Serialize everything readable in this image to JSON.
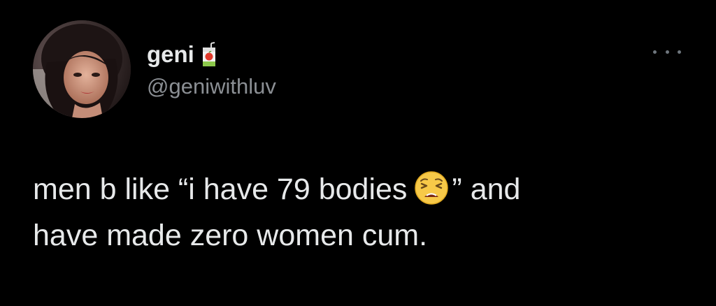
{
  "user": {
    "display_name": "geni",
    "name_emoji_icon": "juice-box-icon",
    "handle": "@geniwithluv",
    "avatar_icon": "profile-photo"
  },
  "menu": {
    "more_icon": "more-options-icon"
  },
  "tweet": {
    "line1_before_emoji": "men b like “i have 79 bodies",
    "emoji_icon": "weary-face-emoji",
    "line1_after_emoji": "” and",
    "line2": "have made zero women cum."
  },
  "colors": {
    "background": "#000000",
    "primary_text": "#e7e9ea",
    "secondary_text": "#8b8f94"
  }
}
